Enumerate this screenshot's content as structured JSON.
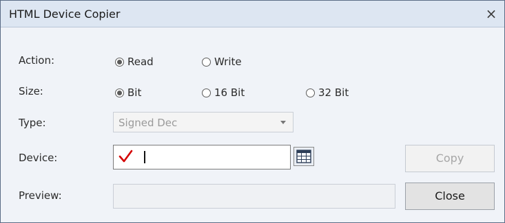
{
  "window": {
    "title": "HTML Device Copier",
    "close_glyph": "×"
  },
  "action": {
    "label": "Action:",
    "options": [
      {
        "label": "Read",
        "selected": true
      },
      {
        "label": "Write",
        "selected": false
      }
    ]
  },
  "size": {
    "label": "Size:",
    "options": [
      {
        "label": "Bit",
        "selected": true
      },
      {
        "label": "16 Bit",
        "selected": false
      },
      {
        "label": "32 Bit",
        "selected": false
      }
    ]
  },
  "type": {
    "label": "Type:",
    "value": "Signed Dec"
  },
  "device": {
    "label": "Device:",
    "value": ""
  },
  "preview": {
    "label": "Preview:",
    "value": ""
  },
  "buttons": {
    "copy": "Copy",
    "close": "Close"
  },
  "icons": {
    "checkmark": "red-checkmark-icon",
    "table": "table-icon"
  },
  "colors": {
    "title_bar": "#dde6f2",
    "checkmark": "#d40000"
  }
}
